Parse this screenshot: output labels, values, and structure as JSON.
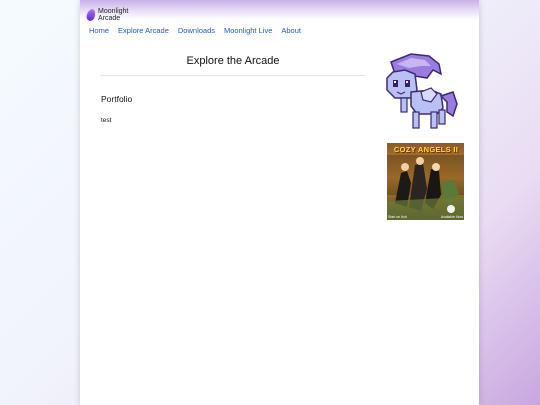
{
  "site": {
    "brand_line1": "Moonlight",
    "brand_line2": "Arcade"
  },
  "nav": {
    "items": [
      "Home",
      "Explore Arcade",
      "Downloads",
      "Moonlight Live",
      "About"
    ]
  },
  "main": {
    "title": "Explore the Arcade",
    "section_heading": "Portfolio",
    "body": "test"
  },
  "sidebar": {
    "banner_title": "COZY ANGELS II",
    "banner_left": "Start on Itch",
    "banner_right": "Available Now",
    "pony_icon": "pixel-pony-sprite"
  },
  "colors": {
    "link": "#1a5fb4",
    "accent": "#b896e3"
  }
}
